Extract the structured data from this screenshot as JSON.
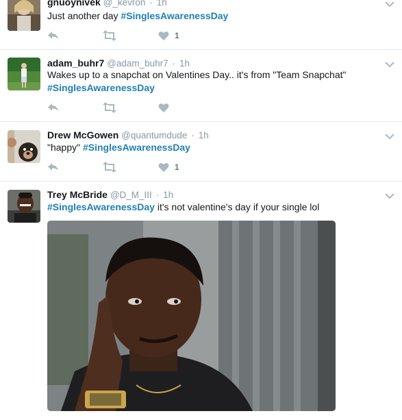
{
  "tweets": [
    {
      "name": "gnuoynivek",
      "handle": "@_kevron",
      "time": "1h",
      "text_pre": "Just another day ",
      "hashtag": "#SinglesAwarenessDay",
      "text_post": "",
      "like_count": "1"
    },
    {
      "name": "adam_buhr7",
      "handle": "@adam_buhr7",
      "time": "1h",
      "text_pre": "Wakes up to a snapchat on Valentines Day.. it's from \"Team Snapchat\"",
      "hashtag": "#SinglesAwarenessDay",
      "text_post": "",
      "like_count": ""
    },
    {
      "name": "Drew McGowen",
      "handle": "@quantumdude",
      "time": "1h",
      "text_pre": "\"happy\" ",
      "hashtag": "#SinglesAwarenessDay",
      "text_post": "",
      "like_count": "1"
    },
    {
      "name": "Trey McBride",
      "handle": "@D_M_III",
      "time": "1h",
      "text_pre": "",
      "hashtag": "#SinglesAwarenessDay",
      "text_post": " it's not valentine's day if your single lol",
      "like_count": ""
    }
  ],
  "separator": "·",
  "icons": {
    "reply": "reply-icon",
    "retweet": "retweet-icon",
    "like": "heart-icon",
    "more": "chevron-down-icon"
  },
  "colors": {
    "hashtag": "#1f7fb6",
    "meta": "#8899a6",
    "action_icon": "#aab8c2",
    "divider": "#e1e8ed"
  }
}
